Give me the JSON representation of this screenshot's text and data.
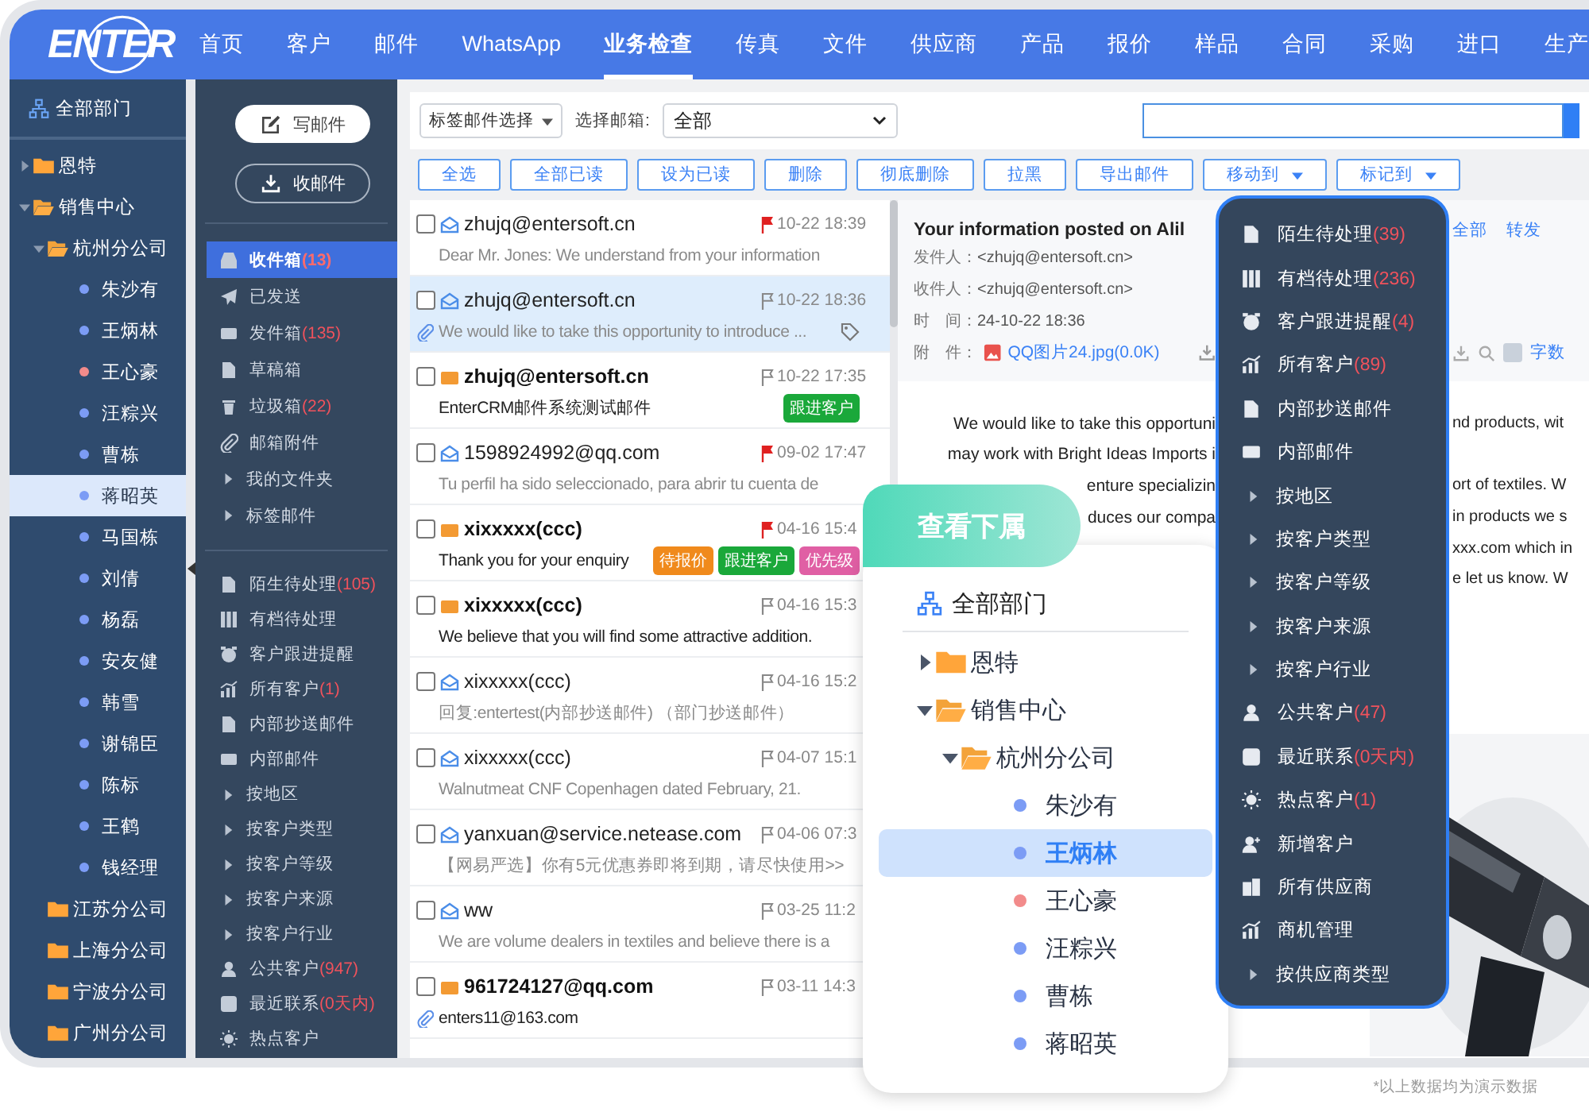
{
  "nav": {
    "logo": "ENTER",
    "items": [
      {
        "label": "首页",
        "selected": false
      },
      {
        "label": "客户",
        "selected": false
      },
      {
        "label": "邮件",
        "selected": false
      },
      {
        "label": "WhatsApp",
        "selected": false
      },
      {
        "label": "业务检查",
        "selected": true
      },
      {
        "label": "传真",
        "selected": false
      },
      {
        "label": "文件",
        "selected": false
      },
      {
        "label": "供应商",
        "selected": false
      },
      {
        "label": "产品",
        "selected": false
      },
      {
        "label": "报价",
        "selected": false
      },
      {
        "label": "样品",
        "selected": false
      },
      {
        "label": "合同",
        "selected": false
      },
      {
        "label": "采购",
        "selected": false
      },
      {
        "label": "进口",
        "selected": false
      },
      {
        "label": "生产",
        "selected": false
      }
    ]
  },
  "sidebar": {
    "header": "全部部门",
    "tree": [
      {
        "label": "恩特",
        "kind": "group",
        "expanded": false,
        "selected": false
      },
      {
        "label": "销售中心",
        "kind": "group",
        "expanded": true,
        "selected": false,
        "children": [
          {
            "label": "杭州分公司",
            "kind": "group",
            "expanded": true,
            "selected": false,
            "children": [
              {
                "label": "朱沙有",
                "kind": "person",
                "color": "#7c9cf5",
                "selected": false
              },
              {
                "label": "王炳林",
                "kind": "person",
                "color": "#7c9cf5",
                "selected": false
              },
              {
                "label": "王心豪",
                "kind": "person",
                "color": "#f28b8b",
                "selected": false
              },
              {
                "label": "汪粽兴",
                "kind": "person",
                "color": "#7c9cf5",
                "selected": false
              },
              {
                "label": "曹栋",
                "kind": "person",
                "color": "#7c9cf5",
                "selected": false
              },
              {
                "label": "蒋昭英",
                "kind": "person",
                "color": "#7c9cf5",
                "selected": true
              },
              {
                "label": "马国栋",
                "kind": "person",
                "color": "#7c9cf5",
                "selected": false
              },
              {
                "label": "刘倩",
                "kind": "person",
                "color": "#7c9cf5",
                "selected": false
              },
              {
                "label": "杨磊",
                "kind": "person",
                "color": "#7c9cf5",
                "selected": false
              },
              {
                "label": "安友健",
                "kind": "person",
                "color": "#7c9cf5",
                "selected": false
              },
              {
                "label": "韩雪",
                "kind": "person",
                "color": "#7c9cf5",
                "selected": false
              },
              {
                "label": "谢锦臣",
                "kind": "person",
                "color": "#7c9cf5",
                "selected": false
              },
              {
                "label": "陈标",
                "kind": "person",
                "color": "#7c9cf5",
                "selected": false
              },
              {
                "label": "王鹤",
                "kind": "person",
                "color": "#7c9cf5",
                "selected": false
              },
              {
                "label": "钱经理",
                "kind": "person",
                "color": "#7c9cf5",
                "selected": false
              }
            ]
          },
          {
            "label": "江苏分公司",
            "kind": "unit",
            "selected": false
          },
          {
            "label": "上海分公司",
            "kind": "unit",
            "selected": false
          },
          {
            "label": "宁波分公司",
            "kind": "unit",
            "selected": false
          },
          {
            "label": "广州分公司",
            "kind": "unit",
            "selected": false
          }
        ]
      }
    ]
  },
  "mail_actions": {
    "compose": "写邮件",
    "receive": "收邮件"
  },
  "mail_folders": [
    {
      "label": "收件箱",
      "count": "(13)",
      "kind": "link",
      "selected": true
    },
    {
      "label": "已发送",
      "kind": "link",
      "selected": false
    },
    {
      "label": "发件箱",
      "count": "(135)",
      "kind": "link",
      "selected": false
    },
    {
      "label": "草稿箱",
      "kind": "link",
      "selected": false
    },
    {
      "label": "垃圾箱",
      "count": "(22)",
      "kind": "link",
      "selected": false
    },
    {
      "label": "邮箱附件",
      "kind": "link",
      "selected": false
    },
    {
      "label": "我的文件夹",
      "kind": "group",
      "selected": false
    },
    {
      "label": "标签邮件",
      "kind": "group",
      "selected": false
    }
  ],
  "customer_views": [
    {
      "label": "陌生待处理",
      "count": "(105)",
      "kind": "link",
      "selected": false
    },
    {
      "label": "有档待处理",
      "kind": "link",
      "selected": false
    },
    {
      "label": "客户跟进提醒",
      "kind": "link",
      "selected": false
    },
    {
      "label": "所有客户",
      "count": "(1)",
      "kind": "link",
      "selected": false
    },
    {
      "label": "内部抄送邮件",
      "kind": "link",
      "selected": false
    },
    {
      "label": "内部邮件",
      "kind": "link",
      "selected": false
    },
    {
      "label": "按地区",
      "kind": "group",
      "selected": false
    },
    {
      "label": "按客户类型",
      "kind": "group",
      "selected": false
    },
    {
      "label": "按客户等级",
      "kind": "group",
      "selected": false
    },
    {
      "label": "按客户来源",
      "kind": "group",
      "selected": false
    },
    {
      "label": "按客户行业",
      "kind": "group",
      "selected": false
    },
    {
      "label": "公共客户",
      "count": "(947)",
      "kind": "link",
      "selected": false
    },
    {
      "label": "最近联系",
      "count": "(0天内)",
      "kind": "link",
      "selected": false
    },
    {
      "label": "热点客户",
      "kind": "link",
      "selected": false
    }
  ],
  "toolbar": {
    "tag_filter": "标签邮件选择",
    "mailbox_label": "选择邮箱:",
    "mailbox": "全部",
    "actions": [
      {
        "label": "全选",
        "dropdown": false
      },
      {
        "label": "全部已读",
        "dropdown": false
      },
      {
        "label": "设为已读",
        "dropdown": false
      },
      {
        "label": "删除",
        "dropdown": false
      },
      {
        "label": "彻底删除",
        "dropdown": false
      },
      {
        "label": "拉黑",
        "dropdown": false
      },
      {
        "label": "导出邮件",
        "dropdown": false
      },
      {
        "label": "移动到",
        "dropdown": true
      },
      {
        "label": "标记到",
        "dropdown": true
      }
    ]
  },
  "emails": [
    {
      "sender": "zhujq@entersoft.cn",
      "time": "10-22 18:39",
      "flagged": true,
      "unread": false,
      "selected": false,
      "attachment": false,
      "labeled": false,
      "preview": "Dear Mr. Jones: We understand from your information"
    },
    {
      "sender": "zhujq@entersoft.cn",
      "time": "10-22 18:36",
      "flagged": false,
      "unread": false,
      "selected": true,
      "attachment": true,
      "labeled": true,
      "preview": "We would like to take this opportunity to introduce ..."
    },
    {
      "sender": "zhujq@entersoft.cn",
      "time": "10-22 17:35",
      "flagged": false,
      "unread": true,
      "selected": false,
      "attachment": false,
      "labeled": false,
      "preview": "EnterCRM邮件系统测试邮件",
      "tags": [
        {
          "label": "跟进客户",
          "color": "#1aa83a"
        }
      ]
    },
    {
      "sender": "1598924992@qq.com",
      "time": "09-02 17:47",
      "flagged": true,
      "unread": false,
      "selected": false,
      "attachment": false,
      "labeled": false,
      "preview": "Tu perfil ha sido seleccionado, para abrir tu cuenta de"
    },
    {
      "sender": "xixxxxx(ccc)",
      "time": "04-16 15:4",
      "flagged": true,
      "unread": true,
      "selected": false,
      "attachment": false,
      "labeled": false,
      "preview": "Thank you for your enquiry",
      "tags": [
        {
          "label": "待报价",
          "color": "#f08a1c"
        },
        {
          "label": "跟进客户",
          "color": "#1aa83a"
        },
        {
          "label": "优先级",
          "color": "#e05fa4"
        }
      ]
    },
    {
      "sender": "xixxxxx(ccc)",
      "time": "04-16 15:3",
      "flagged": false,
      "unread": true,
      "selected": false,
      "attachment": false,
      "labeled": false,
      "preview": "We believe that you will find some attractive addition."
    },
    {
      "sender": "xixxxxx(ccc)",
      "time": "04-16 15:2",
      "flagged": false,
      "unread": false,
      "selected": false,
      "attachment": false,
      "labeled": false,
      "preview": "回复:entertest(内部抄送邮件) （部门抄送邮件）"
    },
    {
      "sender": "xixxxxx(ccc)",
      "time": "04-07 15:1",
      "flagged": false,
      "unread": false,
      "selected": false,
      "attachment": false,
      "labeled": false,
      "preview": "Walnutmeat CNF Copenhagen dated February, 21."
    },
    {
      "sender": "yanxuan@service.netease.com",
      "time": "04-06 07:3",
      "flagged": false,
      "unread": false,
      "selected": false,
      "attachment": false,
      "labeled": false,
      "preview": "【网易严选】你有5元优惠券即将到期，请尽快使用>>"
    },
    {
      "sender": "ww",
      "time": "03-25 11:2",
      "flagged": false,
      "unread": false,
      "selected": false,
      "attachment": false,
      "labeled": false,
      "preview": "We are volume dealers in textiles and believe there is a"
    },
    {
      "sender": "961724127@qq.com",
      "time": "03-11 14:3",
      "flagged": false,
      "unread": true,
      "selected": false,
      "attachment": true,
      "labeled": false,
      "preview": "enters11@163.com"
    }
  ],
  "reading": {
    "subject": "Your information posted on Alil",
    "links": [
      "全部",
      "转发"
    ],
    "fields": [
      {
        "label": "发件人：",
        "value": "<zhujq@entersoft.cn>"
      },
      {
        "label": "收件人：",
        "value": "<zhujq@entersoft.cn>"
      },
      {
        "label": "时　间：",
        "value": "24-10-22 18:36"
      }
    ],
    "attachment_label": "附　件：",
    "attachment": "QQ图片24.jpg(0.0K)",
    "attachment_extra": "字数",
    "body": [
      {
        "start": "We would like to take this opportuni",
        "end": "nd products, wit"
      },
      {
        "start": "may work with Bright Ideas Imports i"
      },
      {
        "start": "enture specializin",
        "end": "ort of textiles. W"
      },
      {
        "start": "duces our compa",
        "end": "in products we s"
      },
      {
        "end": "xxx.com which in"
      },
      {
        "end": "e let us know. W"
      }
    ]
  },
  "quick_menu": [
    {
      "label": "陌生待处理",
      "count": "(39)",
      "kind": "link"
    },
    {
      "label": "有档待处理",
      "count": "(236)",
      "kind": "link"
    },
    {
      "label": "客户跟进提醒",
      "count": "(4)",
      "kind": "link"
    },
    {
      "label": "所有客户",
      "count": "(89)",
      "kind": "link"
    },
    {
      "label": "内部抄送邮件",
      "kind": "link"
    },
    {
      "label": "内部邮件",
      "kind": "link"
    },
    {
      "label": "按地区",
      "kind": "group"
    },
    {
      "label": "按客户类型",
      "kind": "group"
    },
    {
      "label": "按客户等级",
      "kind": "group"
    },
    {
      "label": "按客户来源",
      "kind": "group"
    },
    {
      "label": "按客户行业",
      "kind": "group"
    },
    {
      "label": "公共客户",
      "count": "(47)",
      "kind": "link"
    },
    {
      "label": "最近联系",
      "count": "(0天内)",
      "kind": "link"
    },
    {
      "label": "热点客户",
      "count": "(1)",
      "kind": "link"
    },
    {
      "label": "新增客户",
      "kind": "link"
    },
    {
      "label": "所有供应商",
      "kind": "link"
    },
    {
      "label": "商机管理",
      "kind": "link"
    },
    {
      "label": "按供应商类型",
      "kind": "group"
    }
  ],
  "subordinates": {
    "tab": "查看下属",
    "header": "全部部门",
    "tree": [
      {
        "label": "恩特",
        "kind": "group",
        "expanded": false,
        "selected": false
      },
      {
        "label": "销售中心",
        "kind": "group",
        "expanded": true,
        "selected": false,
        "children": [
          {
            "label": "杭州分公司",
            "kind": "group",
            "expanded": true,
            "selected": false,
            "children": [
              {
                "label": "朱沙有",
                "kind": "person",
                "color": "#7c9cf5",
                "selected": false
              },
              {
                "label": "王炳林",
                "kind": "person",
                "color": "#7c9cf5",
                "selected": true
              },
              {
                "label": "王心豪",
                "kind": "person",
                "color": "#f28b8b",
                "selected": false
              },
              {
                "label": "汪粽兴",
                "kind": "person",
                "color": "#7c9cf5",
                "selected": false
              },
              {
                "label": "曹栋",
                "kind": "person",
                "color": "#7c9cf5",
                "selected": false
              },
              {
                "label": "蒋昭英",
                "kind": "person",
                "color": "#7c9cf5",
                "selected": false
              }
            ]
          }
        ]
      }
    ]
  },
  "note": "*以上数据均为演示数据"
}
